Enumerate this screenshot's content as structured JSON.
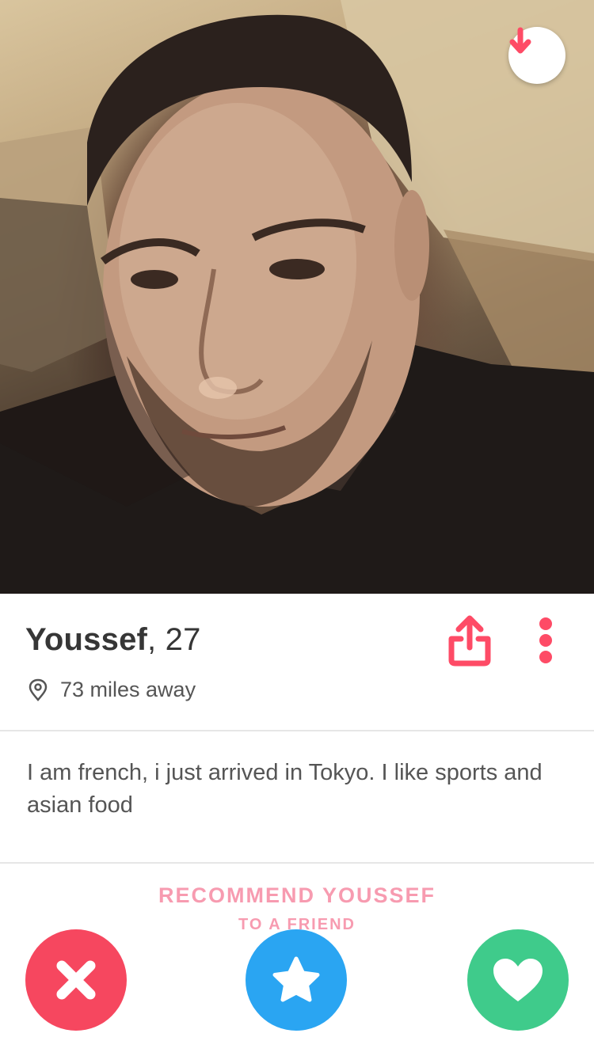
{
  "colors": {
    "nope": "#f6475f",
    "super_like": "#2aa5f2",
    "like": "#3fcb8b",
    "accent": "#fe4b66",
    "recommend_text": "#f79bb0"
  },
  "photo": {
    "alt": "profile photo"
  },
  "top_actions": {
    "collapse_icon": "arrow-down-icon"
  },
  "profile": {
    "name": "Youssef",
    "age_text": ", 27",
    "distance": "73 miles away",
    "bio": "I am french, i just arrived in Tokyo. I like sports and asian food"
  },
  "header_actions": {
    "share_icon": "share-icon",
    "more_icon": "more-vertical-icon"
  },
  "recommend": {
    "line1": "RECOMMEND YOUSSEF",
    "line2": "TO A FRIEND"
  },
  "action_bar": {
    "nope_icon": "x-icon",
    "super_like_icon": "star-icon",
    "like_icon": "heart-icon"
  }
}
